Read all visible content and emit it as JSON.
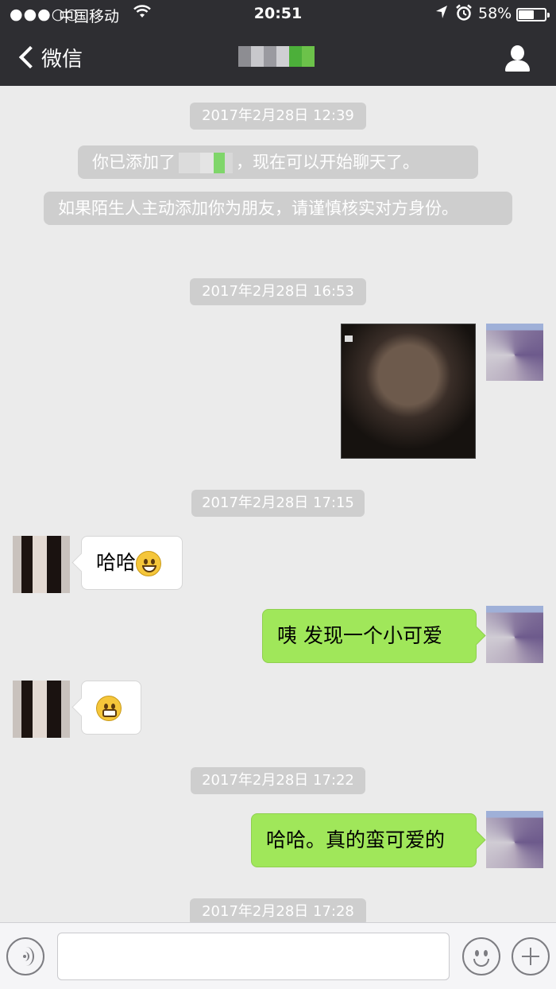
{
  "status_bar": {
    "signal": "●●●○○",
    "carrier": "中国移动",
    "wifi_icon": "wifi-icon",
    "time": "20:51",
    "location_icon": "location-arrow-icon",
    "alarm_icon": "alarm-clock-icon",
    "battery_percent": "58%",
    "battery_level": 0.58
  },
  "nav": {
    "back_label": "微信",
    "title_redacted": true
  },
  "colors": {
    "nav_bg": "#2e2e32",
    "chat_bg": "#ebebeb",
    "outgoing_bubble": "#a0e75a",
    "incoming_bubble": "#ffffff",
    "timestamp_bg": "#cecece"
  },
  "messages": {
    "ts1": "2017年2月28日 12:39",
    "sys_added_prefix": "你已添加了",
    "sys_added_suffix": "，现在可以开始聊天了。",
    "sys_warning": "如果陌生人主动添加你为朋友，请谨慎核实对方身份。",
    "ts2": "2017年2月28日 16:53",
    "ts3": "2017年2月28日 17:15",
    "in1_text": "哈哈",
    "in1_emoji": "grinning-face-emoji",
    "out1_text": "咦  发现一个小可爱",
    "in2_emoji": "grimacing-face-emoji",
    "ts4": "2017年2月28日 17:22",
    "out2_text": "哈哈。真的蛮可爱的",
    "ts5": "2017年2月28日 17:28"
  }
}
